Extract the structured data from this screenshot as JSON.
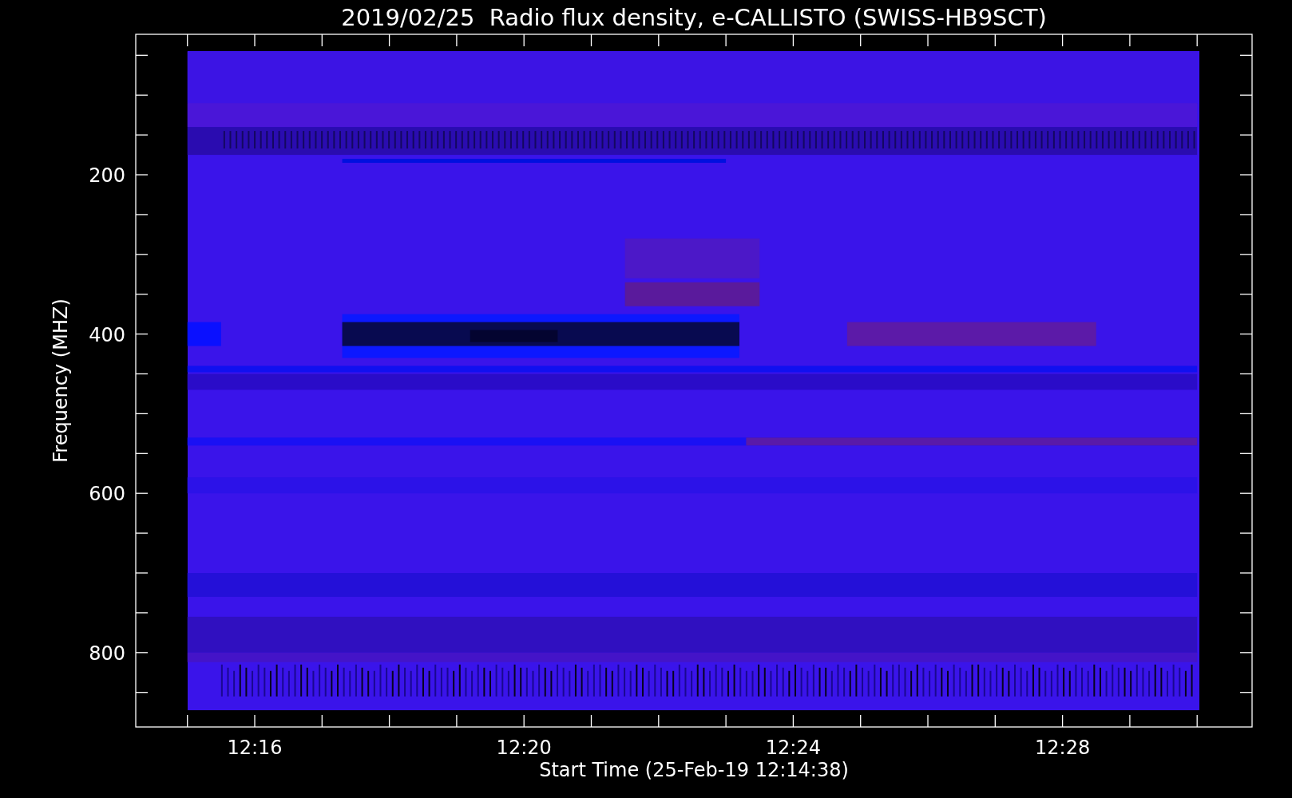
{
  "title": "2019/02/25  Radio flux density, e-CALLISTO (SWISS-HB9SCT)",
  "y_axis": {
    "label": "Frequency (MHZ)",
    "ticks": [
      "200",
      "400",
      "600",
      "800"
    ]
  },
  "x_axis": {
    "label": "Start Time (25-Feb-19 12:14:38)",
    "ticks": [
      "12:16",
      "12:20",
      "12:24",
      "12:28"
    ]
  }
}
